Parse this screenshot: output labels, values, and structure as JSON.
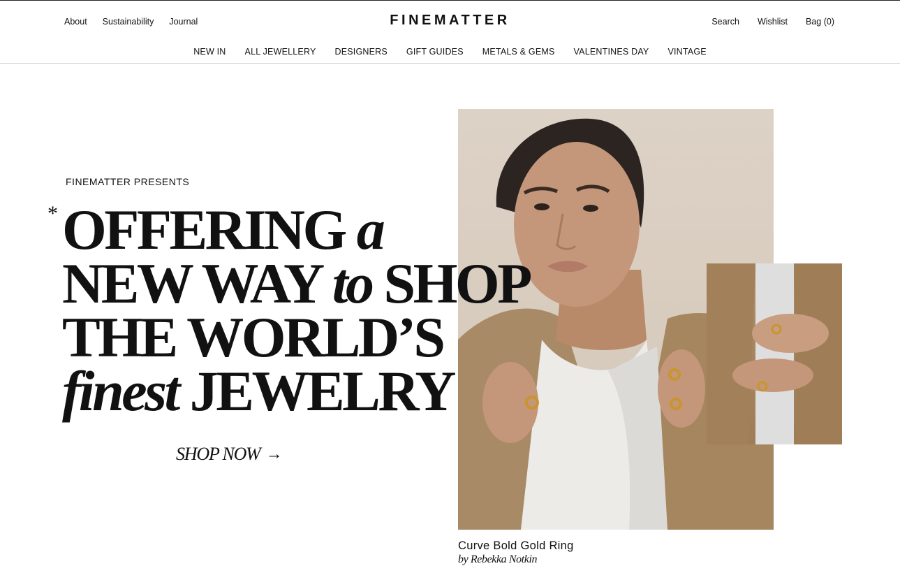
{
  "header": {
    "util_left": [
      "About",
      "Sustainability",
      "Journal"
    ],
    "logo": "FINEMATTER",
    "util_right": [
      "Search",
      "Wishlist",
      "Bag (0)"
    ],
    "nav": [
      "NEW IN",
      "ALL JEWELLERY",
      "DESIGNERS",
      "GIFT GUIDES",
      "METALS & GEMS",
      "VALENTINES DAY",
      "VINTAGE"
    ]
  },
  "hero": {
    "presents": "FINEMATTER PRESENTS",
    "asterisk": "*",
    "line1": {
      "a": "OFFERING",
      "b": "a"
    },
    "line2": {
      "a": "NEW WAY",
      "b": "to",
      "c": "SHOP"
    },
    "line3": {
      "a": "THE WORLD’S"
    },
    "line4": {
      "a": "finest",
      "b": "JEWELRY"
    },
    "cta": "SHOP NOW",
    "cta_arrow": "→"
  },
  "product": {
    "name": "Curve Bold Gold Ring",
    "by": "by Rebekka Notkin"
  },
  "colors": {
    "text": "#111111",
    "background": "#ffffff",
    "divider": "#cfcfcf",
    "gold": "#c8952e"
  }
}
